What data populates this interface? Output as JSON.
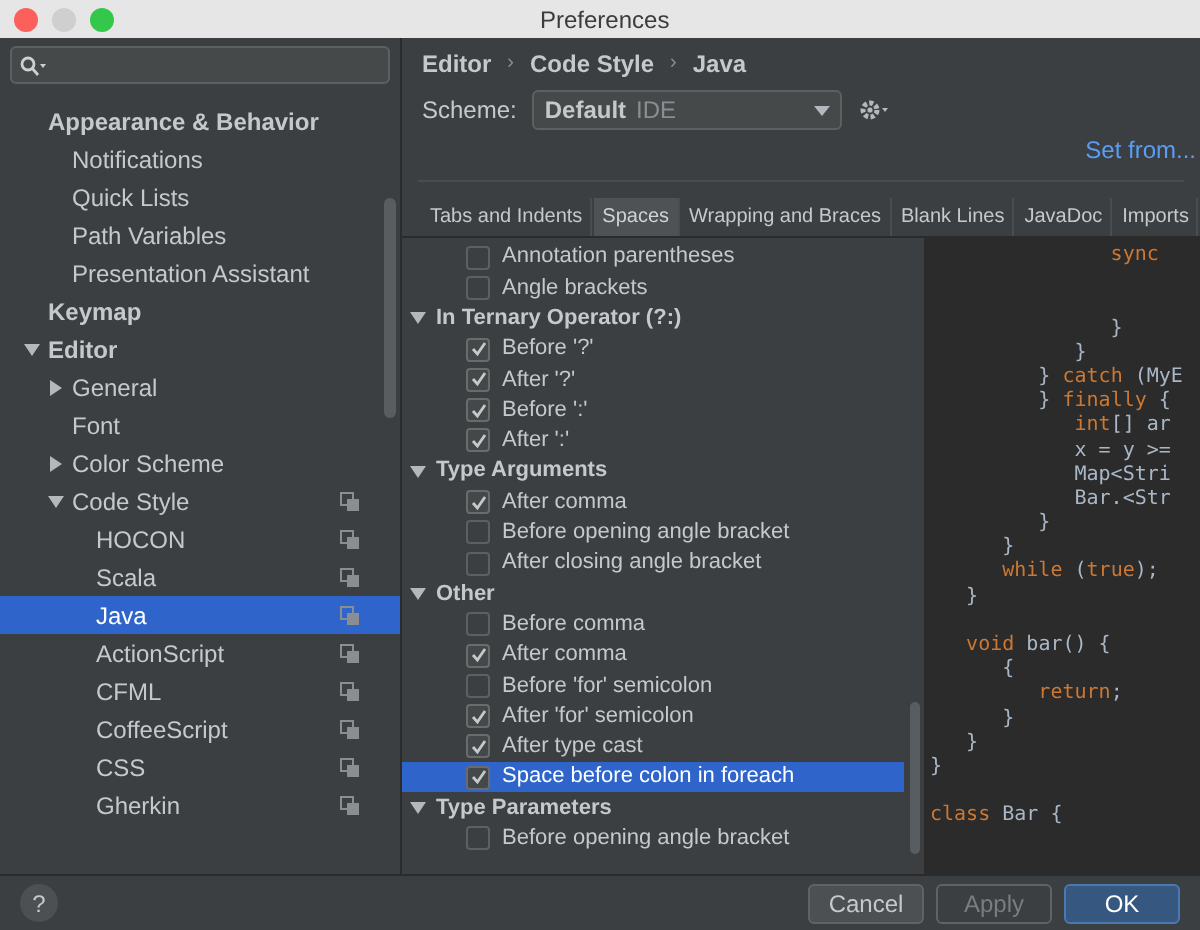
{
  "window": {
    "title": "Preferences"
  },
  "sidebar": {
    "items": [
      {
        "label": "Appearance & Behavior",
        "kind": "header",
        "children": [
          {
            "label": "Notifications"
          },
          {
            "label": "Quick Lists"
          },
          {
            "label": "Path Variables"
          },
          {
            "label": "Presentation Assistant"
          }
        ]
      },
      {
        "label": "Keymap",
        "kind": "header"
      },
      {
        "label": "Editor",
        "kind": "header",
        "expanded": true,
        "children": [
          {
            "label": "General",
            "expanded": false
          },
          {
            "label": "Font"
          },
          {
            "label": "Color Scheme",
            "expanded": false
          },
          {
            "label": "Code Style",
            "expanded": true,
            "scheme_icon": true,
            "children": [
              {
                "label": "HOCON",
                "scheme_icon": true,
                "selected": false
              },
              {
                "label": "Scala",
                "scheme_icon": true,
                "selected": false
              },
              {
                "label": "Java",
                "scheme_icon": true,
                "selected": true
              },
              {
                "label": "ActionScript",
                "scheme_icon": true,
                "selected": false
              },
              {
                "label": "CFML",
                "scheme_icon": true,
                "selected": false
              },
              {
                "label": "CoffeeScript",
                "scheme_icon": true,
                "selected": false
              },
              {
                "label": "CSS",
                "scheme_icon": true,
                "selected": false
              },
              {
                "label": "Gherkin",
                "scheme_icon": true,
                "selected": false
              }
            ]
          }
        ]
      }
    ]
  },
  "breadcrumb": {
    "items": [
      "Editor",
      "Code Style",
      "Java"
    ],
    "separator": "›"
  },
  "scheme": {
    "label": "Scheme:",
    "name": "Default",
    "scope": "IDE"
  },
  "set_from": "Set from...",
  "tabs": [
    {
      "label": "Tabs and Indents",
      "selected": false
    },
    {
      "label": "Spaces",
      "selected": true
    },
    {
      "label": "Wrapping and Braces",
      "selected": false
    },
    {
      "label": "Blank Lines",
      "selected": false
    },
    {
      "label": "JavaDoc",
      "selected": false
    },
    {
      "label": "Imports",
      "selected": false
    }
  ],
  "settings": [
    {
      "options": [
        {
          "label": "Annotation parentheses",
          "checked": false,
          "selected": false
        },
        {
          "label": "Angle brackets",
          "checked": false,
          "selected": false
        }
      ]
    },
    {
      "title": "In Ternary Operator (?:)",
      "expanded": true,
      "options": [
        {
          "label": "Before '?'",
          "checked": true,
          "selected": false
        },
        {
          "label": "After '?'",
          "checked": true,
          "selected": false
        },
        {
          "label": "Before ':'",
          "checked": true,
          "selected": false
        },
        {
          "label": "After ':'",
          "checked": true,
          "selected": false
        }
      ]
    },
    {
      "title": "Type Arguments",
      "expanded": true,
      "options": [
        {
          "label": "After comma",
          "checked": true,
          "selected": false
        },
        {
          "label": "Before opening angle bracket",
          "checked": false,
          "selected": false
        },
        {
          "label": "After closing angle bracket",
          "checked": false,
          "selected": false
        }
      ]
    },
    {
      "title": "Other",
      "expanded": true,
      "options": [
        {
          "label": "Before comma",
          "checked": false,
          "selected": false
        },
        {
          "label": "After comma",
          "checked": true,
          "selected": false
        },
        {
          "label": "Before 'for' semicolon",
          "checked": false,
          "selected": false
        },
        {
          "label": "After 'for' semicolon",
          "checked": true,
          "selected": false
        },
        {
          "label": "After type cast",
          "checked": true,
          "selected": false
        },
        {
          "label": "Space before colon in foreach",
          "checked": true,
          "selected": true
        }
      ]
    },
    {
      "title": "Type Parameters",
      "expanded": true,
      "options": [
        {
          "label": "Before opening angle bracket",
          "checked": false,
          "selected": false
        }
      ]
    }
  ],
  "code": [
    {
      "segments": [
        {
          "text": "               sync",
          "kind": "keyword"
        }
      ]
    },
    {
      "kind": "blank"
    },
    {
      "kind": "blank"
    },
    {
      "segments": [
        {
          "text": "               }"
        }
      ]
    },
    {
      "segments": [
        {
          "text": "            }"
        }
      ]
    },
    {
      "segments": [
        {
          "text": "         } "
        },
        {
          "text": "catch",
          "kind": "keyword"
        },
        {
          "text": " (MyE"
        }
      ]
    },
    {
      "segments": [
        {
          "text": "         } "
        },
        {
          "text": "finally",
          "kind": "keyword"
        },
        {
          "text": " {"
        }
      ]
    },
    {
      "segments": [
        {
          "text": "            int",
          "kind": "keyword"
        },
        {
          "text": "[] ar"
        }
      ]
    },
    {
      "segments": [
        {
          "text": "            x = y >="
        }
      ]
    },
    {
      "segments": [
        {
          "text": "            Map<Stri"
        }
      ]
    },
    {
      "segments": [
        {
          "text": "            Bar.<Str"
        }
      ]
    },
    {
      "segments": [
        {
          "text": "         }"
        }
      ]
    },
    {
      "segments": [
        {
          "text": "      }"
        }
      ]
    },
    {
      "segments": [
        {
          "text": "      while",
          "kind": "keyword"
        },
        {
          "text": " ("
        },
        {
          "text": "true",
          "kind": "keyword"
        },
        {
          "text": ");"
        }
      ]
    },
    {
      "segments": [
        {
          "text": "   }"
        }
      ]
    },
    {
      "kind": "blank"
    },
    {
      "segments": [
        {
          "text": "   void",
          "kind": "keyword"
        },
        {
          "text": " bar() {"
        }
      ]
    },
    {
      "segments": [
        {
          "text": "      {"
        }
      ]
    },
    {
      "segments": [
        {
          "text": "         return",
          "kind": "keyword"
        },
        {
          "text": ";"
        }
      ]
    },
    {
      "segments": [
        {
          "text": "      }"
        }
      ]
    },
    {
      "segments": [
        {
          "text": "   }"
        }
      ]
    },
    {
      "segments": [
        {
          "text": "}"
        }
      ]
    },
    {
      "kind": "blank"
    },
    {
      "segments": [
        {
          "text": "class",
          "kind": "keyword"
        },
        {
          "text": " Bar {"
        }
      ]
    }
  ],
  "buttons": [
    {
      "label": "Cancel",
      "kind": "normal"
    },
    {
      "label": "Apply",
      "kind": "disabled"
    },
    {
      "label": "OK",
      "kind": "default"
    }
  ],
  "help": {
    "label": "?"
  }
}
